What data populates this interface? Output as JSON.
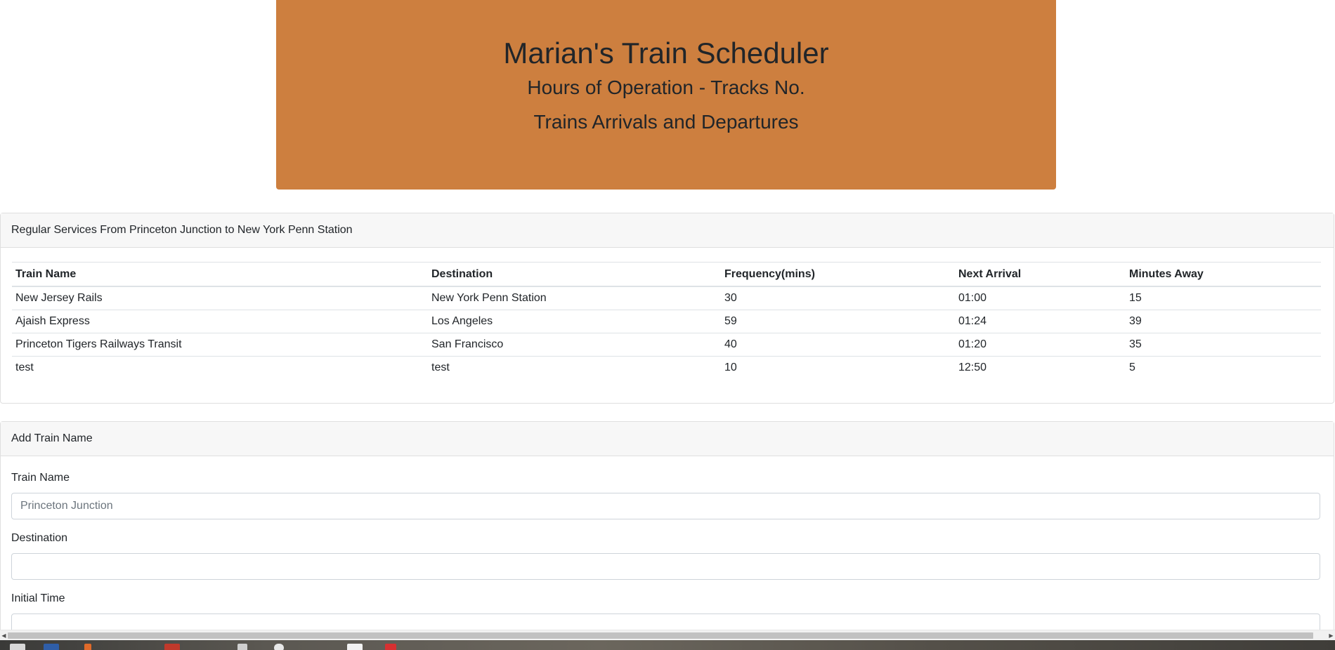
{
  "header": {
    "title": "Marian's Train Scheduler",
    "subtitle_1": "Hours of Operation - Tracks No.",
    "subtitle_2": "Trains Arrivals and Departures",
    "background_color": "#cd7f3f"
  },
  "schedule": {
    "card_title": "Regular Services From Princeton Junction to New York Penn Station",
    "columns": [
      "Train Name",
      "Destination",
      "Frequency(mins)",
      "Next Arrival",
      "Minutes Away"
    ],
    "rows": [
      [
        "New Jersey Rails",
        "New York Penn Station",
        "30",
        "01:00",
        "15"
      ],
      [
        "Ajaish Express",
        "Los Angeles",
        "59",
        "01:24",
        "39"
      ],
      [
        "Princeton Tigers Railways Transit",
        "San Francisco",
        "40",
        "01:20",
        "35"
      ],
      [
        "test",
        "test",
        "10",
        "12:50",
        "5"
      ]
    ]
  },
  "add_form": {
    "card_title": "Add Train Name",
    "fields": [
      {
        "label": "Train Name",
        "value": "",
        "placeholder": "Princeton Junction"
      },
      {
        "label": "Destination",
        "value": "",
        "placeholder": ""
      },
      {
        "label": "Initial Time",
        "value": "",
        "placeholder": ""
      }
    ]
  },
  "scrollbar": {
    "left_arrow_icon": "chevron-left-icon",
    "right_arrow_icon": "chevron-right-icon"
  }
}
